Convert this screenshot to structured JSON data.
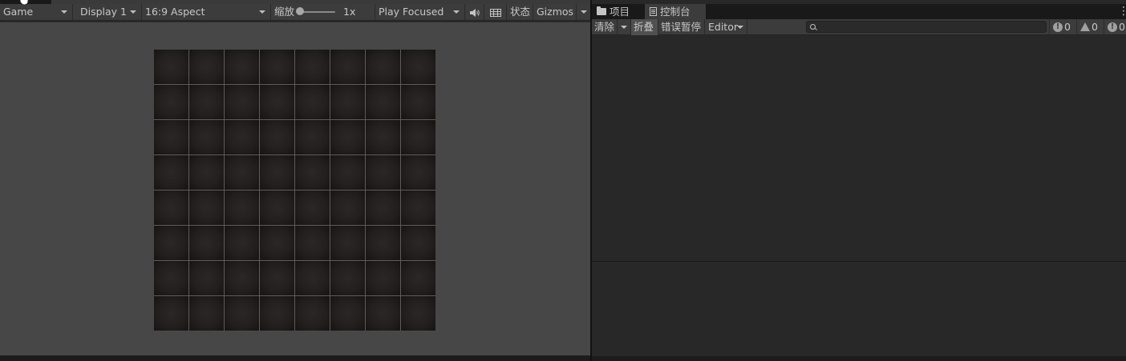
{
  "game": {
    "tab_label": "Game",
    "display": "Display 1",
    "aspect": "16:9 Aspect",
    "scale_label": "缩放",
    "scale_value": "1x",
    "scale_level": 0.0,
    "play_mode": "Play Focused",
    "audio_icon": "speaker-icon",
    "stats_icon": "keyboard-grid-icon",
    "stats_label": "状态",
    "gizmos_label": "Gizmos",
    "board": {
      "rows": 8,
      "cols": 8
    }
  },
  "console": {
    "tabs": [
      {
        "label": "项目",
        "icon": "folder-icon"
      },
      {
        "label": "控制台",
        "icon": "console-icon"
      }
    ],
    "toolbar": {
      "clear_label": "清除",
      "collapse_label": "折叠",
      "error_pause_label": "错误暂停",
      "editor_label": "Editor",
      "search_placeholder": ""
    },
    "counts": {
      "info": "0",
      "warning": "0",
      "error": "0"
    }
  },
  "colors": {
    "game_bg": "#474747",
    "toolbar_bg": "#3c3c3c",
    "panel_bg": "#282828",
    "board_grid": "#5c5c5c",
    "cell": "#231f1e"
  }
}
